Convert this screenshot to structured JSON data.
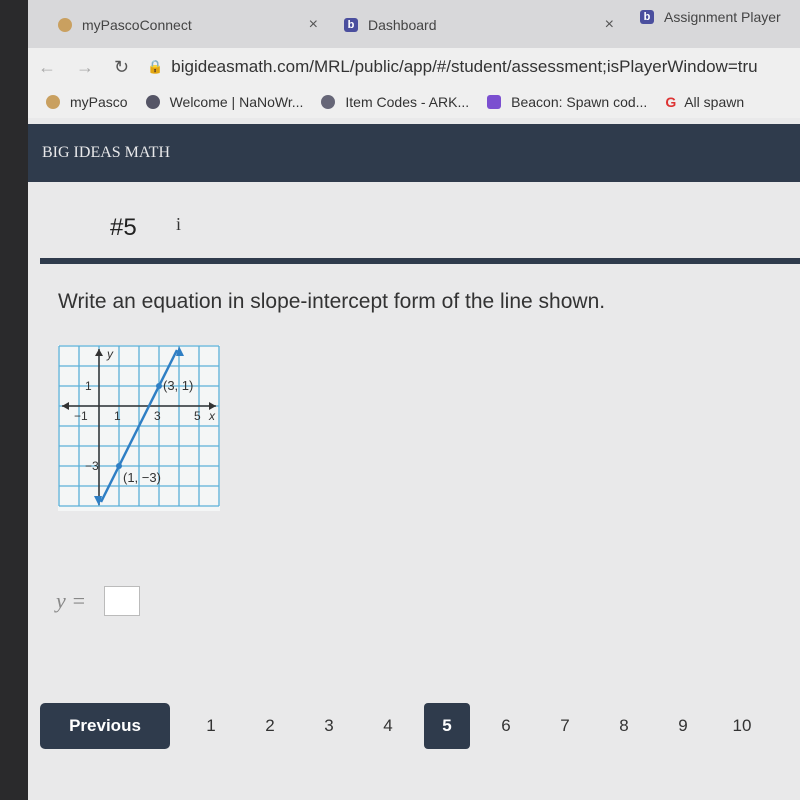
{
  "browser": {
    "tabs": [
      {
        "label": "myPascoConnect"
      },
      {
        "label": "Dashboard"
      },
      {
        "label": "Assignment Player"
      }
    ],
    "url": "bigideasmath.com/MRL/public/app/#/student/assessment;isPlayerWindow=tru",
    "bookmarks": [
      {
        "label": "myPasco"
      },
      {
        "label": "Welcome | NaNoWr..."
      },
      {
        "label": "Item Codes - ARK..."
      },
      {
        "label": "Beacon: Spawn cod..."
      },
      {
        "label": "All spawn"
      }
    ]
  },
  "header": {
    "title": "BIG IDEAS MATH"
  },
  "question": {
    "number": "#5",
    "info": "i",
    "prompt": "Write an equation in slope-intercept form of the line shown.",
    "graph": {
      "x_label": "x",
      "y_label": "y",
      "x_ticks": [
        "−1",
        "1",
        "3",
        "5"
      ],
      "y_ticks": [
        "1",
        "−3"
      ],
      "points": [
        {
          "label": "(3, 1)",
          "x": 3,
          "y": 1
        },
        {
          "label": "(1, −3)",
          "x": 1,
          "y": -3
        }
      ],
      "line_color": "#2f7fc4",
      "grid_color": "#5ab0d8"
    },
    "answer_label": "y =",
    "answer_value": ""
  },
  "pager": {
    "previous": "Previous",
    "pages": [
      "1",
      "2",
      "3",
      "4",
      "5",
      "6",
      "7",
      "8",
      "9",
      "10"
    ],
    "current": "5"
  }
}
